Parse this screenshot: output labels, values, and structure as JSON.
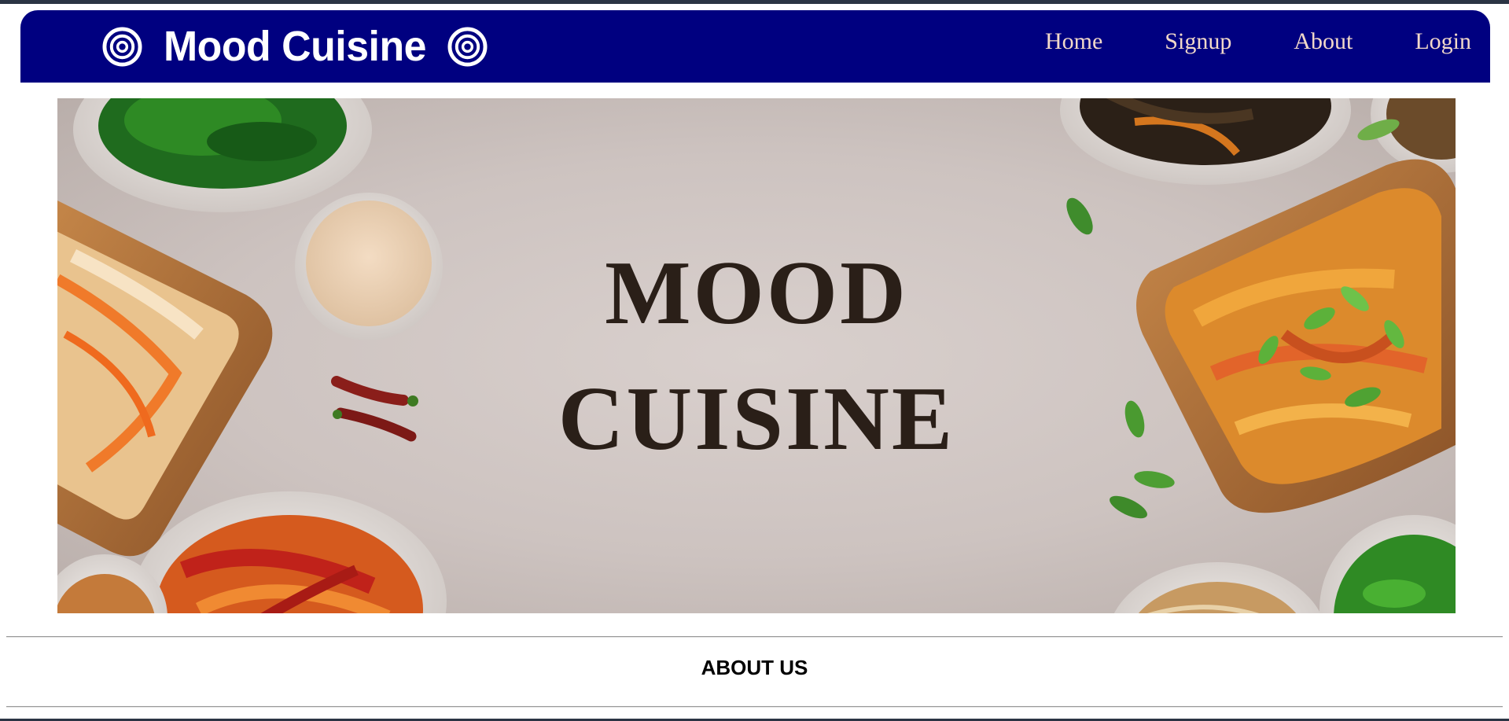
{
  "header": {
    "brand_title": "Mood Cuisine",
    "brand_icon": "concentric-circles-icon",
    "background_color": "#000080",
    "nav_text_color": "#f2d9c9"
  },
  "nav": {
    "items": [
      {
        "label": "Home"
      },
      {
        "label": "Signup"
      },
      {
        "label": "About"
      },
      {
        "label": "Login"
      }
    ]
  },
  "hero": {
    "title_line1": "MOOD",
    "title_line2": "CUISINE",
    "title_color": "#2a1f18",
    "image_description_icon": "food-bowls-image"
  },
  "about": {
    "heading": "ABOUT US"
  }
}
